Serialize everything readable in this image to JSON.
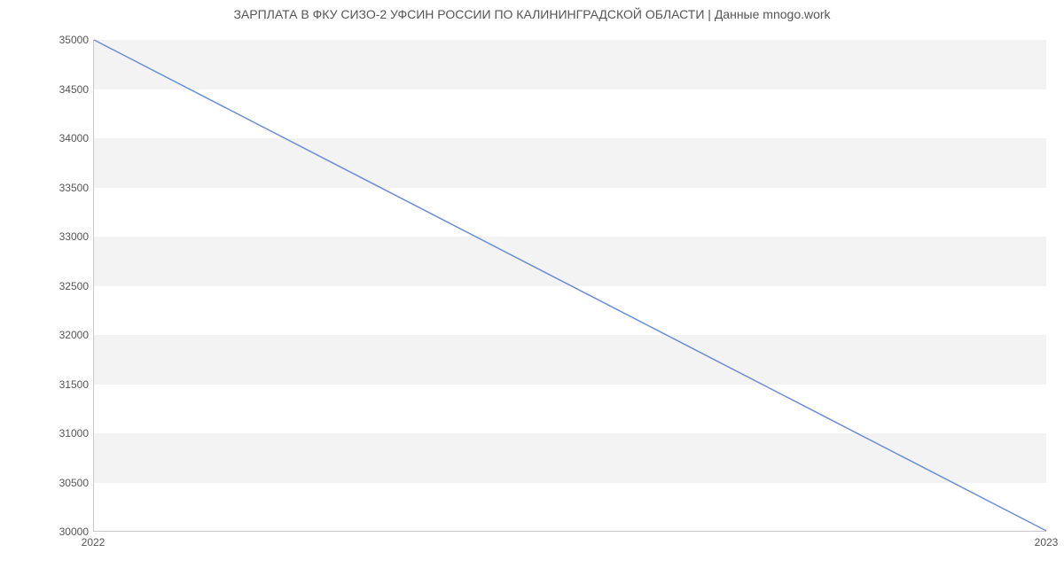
{
  "chart_data": {
    "type": "line",
    "title": "ЗАРПЛАТА В ФКУ СИЗО-2 УФСИН РОССИИ ПО КАЛИНИНГРАДСКОЙ ОБЛАСТИ | Данные mnogo.work",
    "x": [
      2022,
      2023
    ],
    "values": [
      35000,
      30000
    ],
    "xticks": [
      "2022",
      "2023"
    ],
    "yticks": [
      "30000",
      "30500",
      "31000",
      "31500",
      "32000",
      "32500",
      "33000",
      "33500",
      "34000",
      "34500",
      "35000"
    ],
    "xlim": [
      2022,
      2023
    ],
    "ylim": [
      30000,
      35000
    ],
    "xlabel": "",
    "ylabel": "",
    "grid": "alternating-bands",
    "line_color": "#6a8fd8"
  }
}
